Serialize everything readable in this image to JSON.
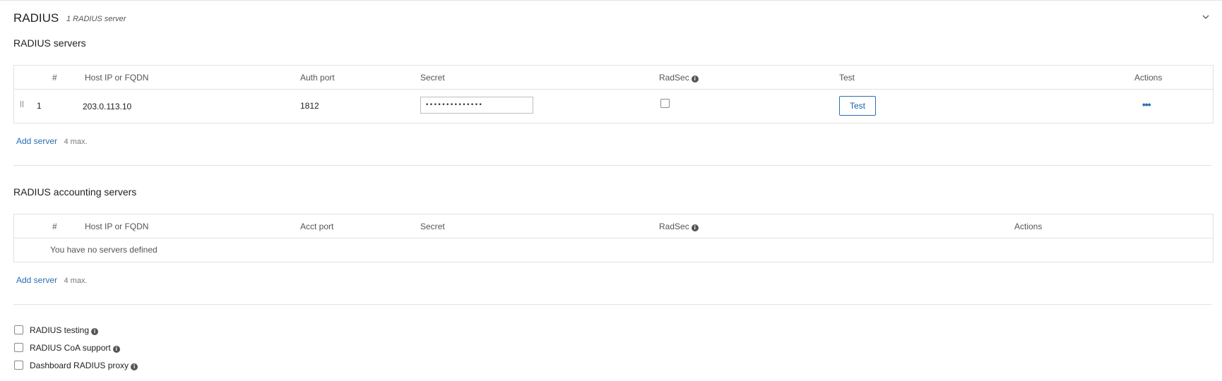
{
  "header": {
    "title": "RADIUS",
    "subtitle": "1 RADIUS server",
    "collapse_icon": "chevron-down-icon"
  },
  "radius_servers": {
    "heading": "RADIUS servers",
    "columns": [
      "#",
      "Host IP or FQDN",
      "Auth port",
      "Secret",
      "RadSec",
      "Test",
      "Actions"
    ],
    "rows": [
      {
        "index": "1",
        "host": "203.0.113.10",
        "port": "1812",
        "secret_masked": "••••••••••••••",
        "radsec_checked": false,
        "test_label": "Test",
        "actions_label": "•••"
      }
    ],
    "add_label": "Add server",
    "max_note": "4 max."
  },
  "accounting_servers": {
    "heading": "RADIUS accounting servers",
    "columns": [
      "#",
      "Host IP or FQDN",
      "Acct port",
      "Secret",
      "RadSec",
      "Actions"
    ],
    "empty_message": "You have no servers defined",
    "add_label": "Add server",
    "max_note": "4 max."
  },
  "options": [
    {
      "label": "RADIUS testing",
      "checked": false
    },
    {
      "label": "RADIUS CoA support",
      "checked": false
    },
    {
      "label": "Dashboard RADIUS proxy",
      "checked": false
    }
  ],
  "colors": {
    "link": "#2a6db5",
    "border": "#e2e2e2"
  }
}
